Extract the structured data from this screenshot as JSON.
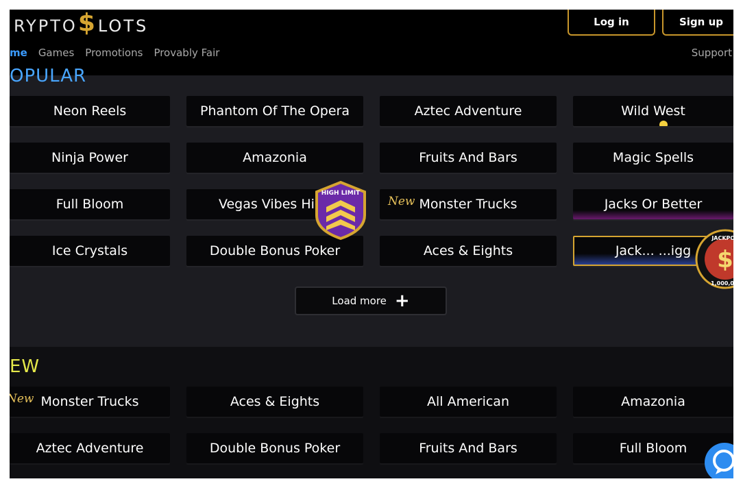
{
  "logo": {
    "prefix": "RYPTO",
    "dollar": "$",
    "suffix": "LOTS"
  },
  "header": {
    "login": "Log in",
    "signup": "Sign up",
    "support": "Support"
  },
  "nav": [
    "me",
    "Games",
    "Promotions",
    "Provably Fair"
  ],
  "sections": {
    "popular": {
      "title": "OPULAR"
    },
    "new": {
      "title": "EW"
    }
  },
  "popular_tiles": [
    {
      "label": "Neon Reels"
    },
    {
      "label": "Phantom Of The Opera"
    },
    {
      "label": "Aztec Adventure"
    },
    {
      "label": "Wild West"
    },
    {
      "label": "Ninja Power"
    },
    {
      "label": "Amazonia"
    },
    {
      "label": "Fruits And Bars"
    },
    {
      "label": "Magic Spells"
    },
    {
      "label": "Full Bloom"
    },
    {
      "label": "Vegas Vibes High"
    },
    {
      "label": "Monster Trucks",
      "tag": "New"
    },
    {
      "label": "Jacks Or Better"
    },
    {
      "label": "Ice Crystals"
    },
    {
      "label": "Double Bonus Poker"
    },
    {
      "label": "Aces & Eights"
    },
    {
      "label": "Jack... ...igg"
    }
  ],
  "load_more": "Load more",
  "new_tiles": [
    {
      "label": "Monster Trucks",
      "tag": "New"
    },
    {
      "label": "Aces & Eights"
    },
    {
      "label": "All American"
    },
    {
      "label": "Amazonia"
    },
    {
      "label": "Aztec Adventure"
    },
    {
      "label": "Double Bonus Poker"
    },
    {
      "label": "Fruits And Bars"
    },
    {
      "label": "Full Bloom"
    }
  ],
  "badges": {
    "high_limit": {
      "text": "HIGH LIMIT"
    },
    "jackpot": {
      "text": "JACKPOT",
      "amount": "1,000,0"
    }
  },
  "icons": {
    "chat": "chat-icon",
    "plus": "plus-icon"
  },
  "colors": {
    "accent_gold": "#d6a531",
    "nav_active": "#3b9bff",
    "popular_title": "#49a6ff",
    "new_title": "#e5e84a"
  }
}
